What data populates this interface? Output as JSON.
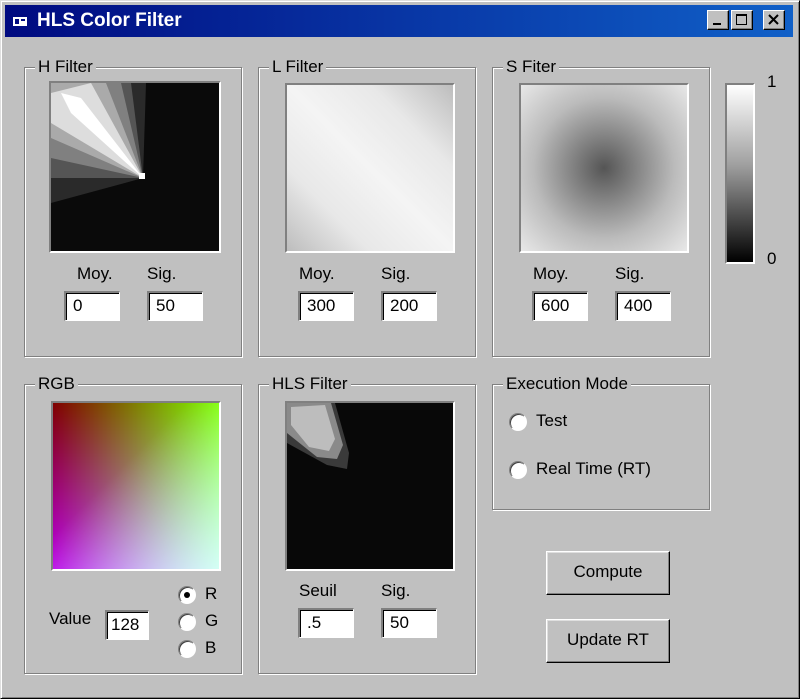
{
  "window": {
    "title": "HLS Color Filter"
  },
  "h_filter": {
    "label": "H Filter",
    "moy_label": "Moy.",
    "sig_label": "Sig.",
    "moy_value": "0",
    "sig_value": "50"
  },
  "l_filter": {
    "label": "L Filter",
    "moy_label": "Moy.",
    "sig_label": "Sig.",
    "moy_value": "300",
    "sig_value": "200"
  },
  "s_filter": {
    "label": "S Fiter",
    "moy_label": "Moy.",
    "sig_label": "Sig.",
    "moy_value": "600",
    "sig_value": "400"
  },
  "scale": {
    "max_label": "1",
    "min_label": "0"
  },
  "rgb": {
    "label": "RGB",
    "value_label": "Value",
    "value": "128",
    "channels": [
      {
        "label": "R",
        "selected": true
      },
      {
        "label": "G",
        "selected": false
      },
      {
        "label": "B",
        "selected": false
      }
    ]
  },
  "hls_filter": {
    "label": "HLS Filter",
    "seuil_label": "Seuil",
    "sig_label": "Sig.",
    "seuil_value": ".5",
    "sig_value": "50"
  },
  "execution_mode": {
    "label": "Execution Mode",
    "options": [
      {
        "label": "Test",
        "selected": false
      },
      {
        "label": "Real Time (RT)",
        "selected": false
      }
    ]
  },
  "buttons": {
    "compute": "Compute",
    "update_rt": "Update RT"
  }
}
